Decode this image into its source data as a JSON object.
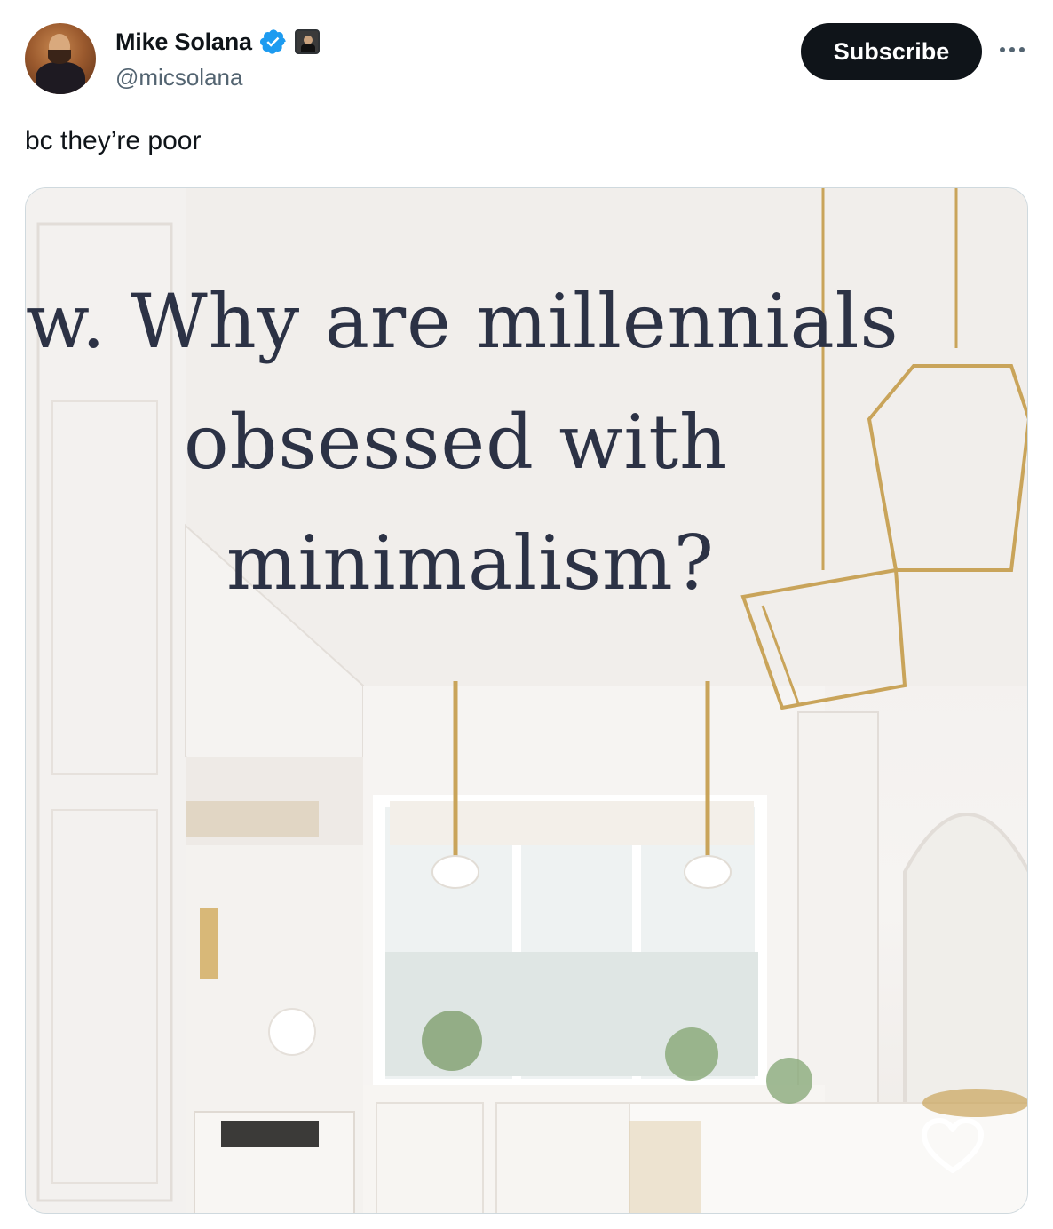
{
  "author": {
    "display_name": "Mike Solana",
    "handle": "@micsolana",
    "avatar_icon": "portrait-avatar",
    "verified_icon": "verified-badge-icon",
    "affiliation_icon": "affiliate-badge-icon"
  },
  "actions": {
    "subscribe_label": "Subscribe",
    "more_icon": "more-options-icon"
  },
  "tweet": {
    "text": "bc they’re poor"
  },
  "media": {
    "overlay_lines": [
      "w. Why are millennials",
      "obsessed with",
      "minimalism?"
    ],
    "like_icon": "heart-outline-icon",
    "text_color": "#2c3245"
  },
  "colors": {
    "primary_text": "#0f1419",
    "secondary_text": "#536471",
    "button_bg": "#0f1419",
    "button_text": "#ffffff",
    "verified_blue": "#1d9bf0",
    "brass": "#c9a45a"
  }
}
